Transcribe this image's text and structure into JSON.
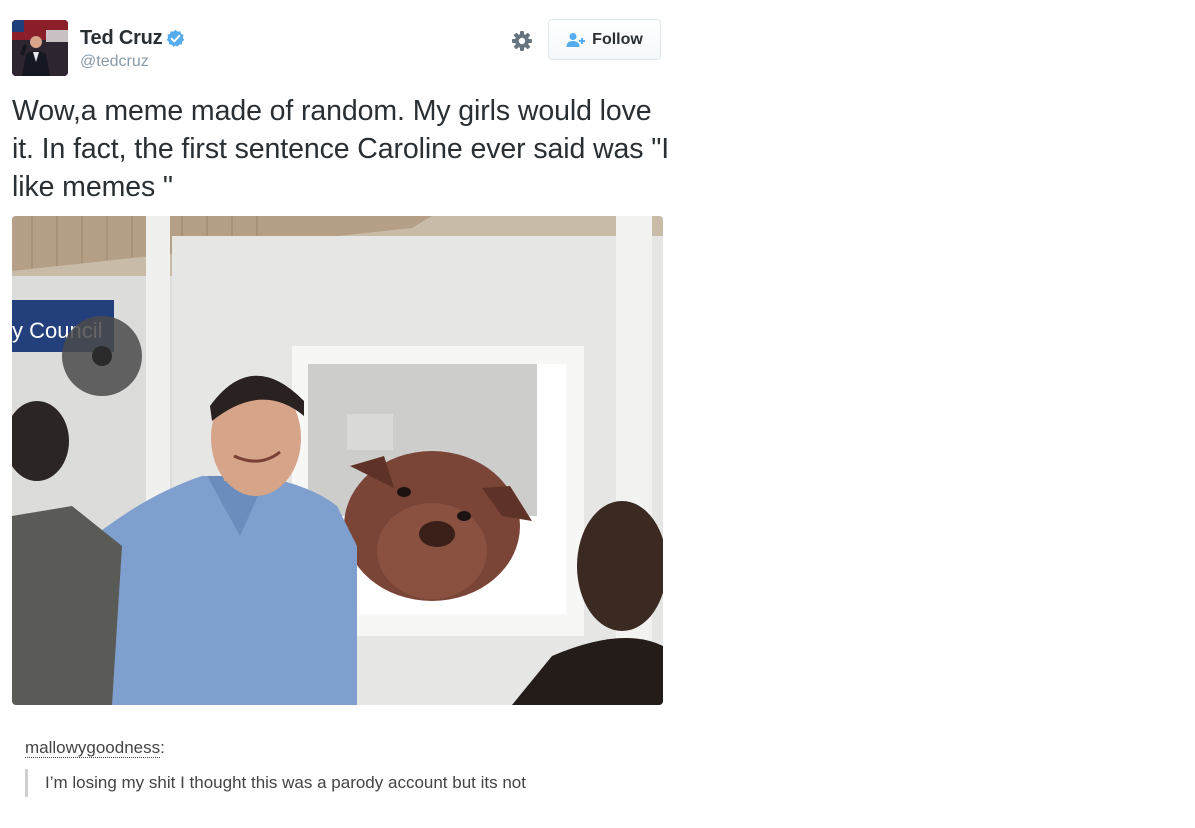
{
  "tweet": {
    "display_name": "Ted Cruz",
    "handle": "@tedcruz",
    "follow_label": "Follow",
    "text": "Wow,a meme made of random. My girls would love it. In fact, the first sentence Caroline ever said was \"I like memes \"",
    "photo": {
      "sign_text": "y Council"
    },
    "icons": {
      "verified": "verified-badge-icon",
      "settings": "gear-icon",
      "follow": "add-user-icon"
    },
    "colors": {
      "verified_blue": "#55acee",
      "follow_icon_blue": "#55acee",
      "text": "#292f33",
      "handle": "#8899a6"
    }
  },
  "reblog": {
    "username": "mallowygoodness",
    "colon": ":",
    "quote": "I’m losing my shit I thought this was a parody account but its not"
  }
}
